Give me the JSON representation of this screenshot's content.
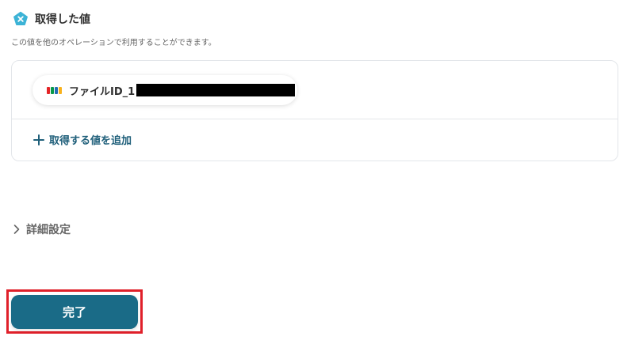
{
  "section": {
    "title": "取得した値",
    "description": "この値を他のオペレーションで利用することができます。",
    "icon": "pentagon-x-icon",
    "icon_color": "#3cb3d6"
  },
  "values": {
    "items": [
      {
        "label": "ファイルID_1",
        "app_icon": "zoho-logo-icon",
        "redacted": true
      }
    ],
    "add_label": "取得する値を追加"
  },
  "advanced": {
    "label": "詳細設定"
  },
  "footer": {
    "done_label": "完了",
    "highlight_color": "#e0202a",
    "button_color": "#1a6b87"
  }
}
